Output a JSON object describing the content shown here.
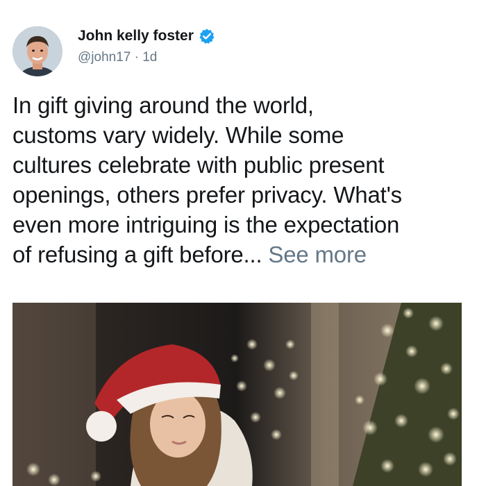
{
  "author": {
    "display_name": "John kelly foster",
    "handle": "@john17",
    "separator": " · ",
    "timestamp": "1d",
    "verified": true,
    "verified_icon": "verified-badge-icon",
    "avatar_icon": "user-avatar"
  },
  "post": {
    "text_lines": [
      "In gift giving around the world,",
      "customs vary widely. While some",
      "cultures celebrate with public present",
      "openings, others prefer privacy. What's",
      "even more intriguing is the expectation",
      "of refusing a gift before..."
    ],
    "see_more_label": "See more"
  },
  "colors": {
    "verified_blue": "#1da1f2",
    "muted_text": "#657786",
    "primary_text": "#14171a"
  }
}
